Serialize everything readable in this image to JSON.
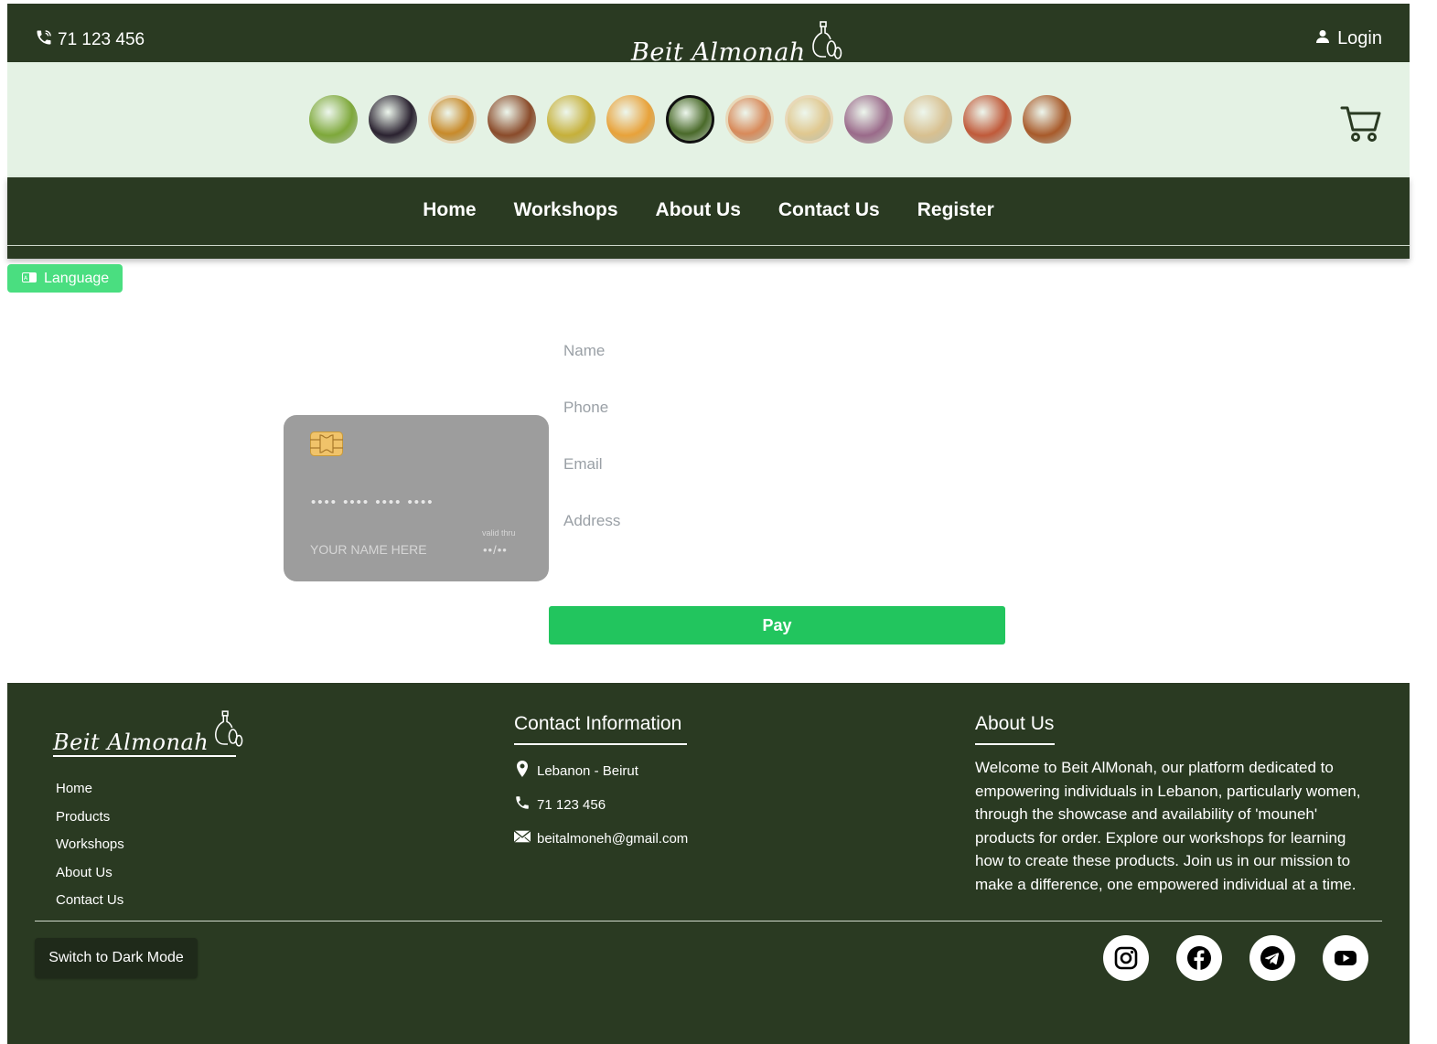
{
  "header": {
    "phone": "71 123 456",
    "logo_text": "Beit Almonah",
    "login_label": "Login"
  },
  "products": [
    {
      "icon": "olives-icon",
      "color": "#7ea83a"
    },
    {
      "icon": "blackberries-icon",
      "color": "#2a2230"
    },
    {
      "icon": "hummus-icon",
      "color": "#c88a2a"
    },
    {
      "icon": "cinnamon-icon",
      "color": "#8a4b2a"
    },
    {
      "icon": "olive-oil-icon",
      "color": "#c6b03a"
    },
    {
      "icon": "honey-icon",
      "color": "#e8a23a"
    },
    {
      "icon": "stuffed-leaves-icon",
      "color": "#4a6a2a"
    },
    {
      "icon": "salad-icon",
      "color": "#d88a5a"
    },
    {
      "icon": "dish-icon",
      "color": "#e0c890"
    },
    {
      "icon": "jam-jar-icon",
      "color": "#9a6a8a"
    },
    {
      "icon": "bread-icon",
      "color": "#d8c090"
    },
    {
      "icon": "spice-jars-icon",
      "color": "#c05a3a"
    },
    {
      "icon": "falafel-icon",
      "color": "#a85a2a"
    }
  ],
  "nav": {
    "items": [
      "Home",
      "Workshops",
      "About Us",
      "Contact Us",
      "Register"
    ]
  },
  "language_label": "Language",
  "card": {
    "number": "•••• •••• •••• ••••",
    "name": "YOUR NAME HERE",
    "valid_label": "valid thru",
    "expiry": "••/••"
  },
  "form": {
    "name_placeholder": "Name",
    "phone_placeholder": "Phone",
    "email_placeholder": "Email",
    "address_placeholder": "Address",
    "pay_label": "Pay"
  },
  "footer": {
    "logo_text": "Beit Almonah",
    "links": [
      "Home",
      "Products",
      "Workshops",
      "About Us",
      "Contact Us"
    ],
    "contact_title": "Contact Information",
    "location": "Lebanon - Beirut",
    "phone": "71 123 456",
    "email": "beitalmoneh@gmail.com",
    "about_title": "About Us",
    "about_text": "Welcome to Beit AlMonah, our platform dedicated to empowering individuals in Lebanon, particularly women, through the showcase and availability of 'mouneh' products for order. Explore our workshops for learning how to create these products. Join us in our mission to make a difference, one empowered individual at a time.",
    "dark_mode_label": "Switch to Dark Mode",
    "social": [
      "instagram-icon",
      "facebook-icon",
      "telegram-icon",
      "youtube-icon"
    ]
  },
  "colors": {
    "dark_green": "#2a3a22",
    "light_green_bg": "#e4f2e4",
    "accent_green": "#22c55e",
    "language_green": "#4ade80"
  }
}
